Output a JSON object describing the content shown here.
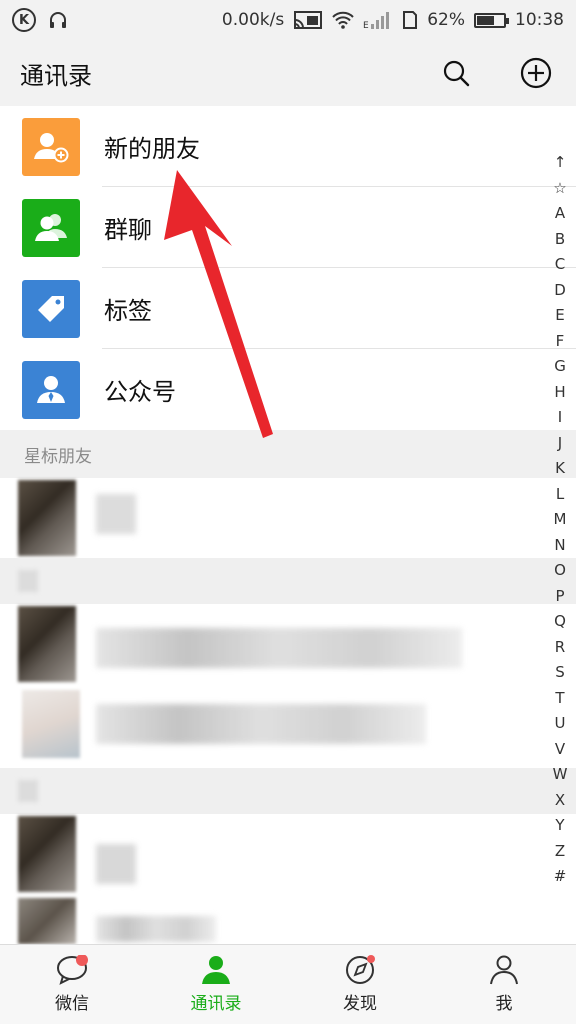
{
  "status_bar": {
    "speed": "0.00k/s",
    "battery": "62%",
    "time": "10:38"
  },
  "header": {
    "title": "通讯录"
  },
  "entries": [
    {
      "label": "新的朋友",
      "color": "#fa9d3b",
      "icon": "add-friend-icon"
    },
    {
      "label": "群聊",
      "color": "#1aad19",
      "icon": "group-chat-icon"
    },
    {
      "label": "标签",
      "color": "#3b83d4",
      "icon": "tag-icon"
    },
    {
      "label": "公众号",
      "color": "#3b83d4",
      "icon": "official-account-icon"
    }
  ],
  "section": {
    "starred_label": "星标朋友"
  },
  "index_letters": [
    "↑",
    "☆",
    "A",
    "B",
    "C",
    "D",
    "E",
    "F",
    "G",
    "H",
    "I",
    "J",
    "K",
    "L",
    "M",
    "N",
    "O",
    "P",
    "Q",
    "R",
    "S",
    "T",
    "U",
    "V",
    "W",
    "X",
    "Y",
    "Z",
    "#"
  ],
  "bottom_nav": [
    {
      "label": "微信",
      "active": false
    },
    {
      "label": "通讯录",
      "active": true
    },
    {
      "label": "发现",
      "active": false
    },
    {
      "label": "我",
      "active": false
    }
  ],
  "accent_color": "#1aad19",
  "annotation_color": "#e8262c"
}
